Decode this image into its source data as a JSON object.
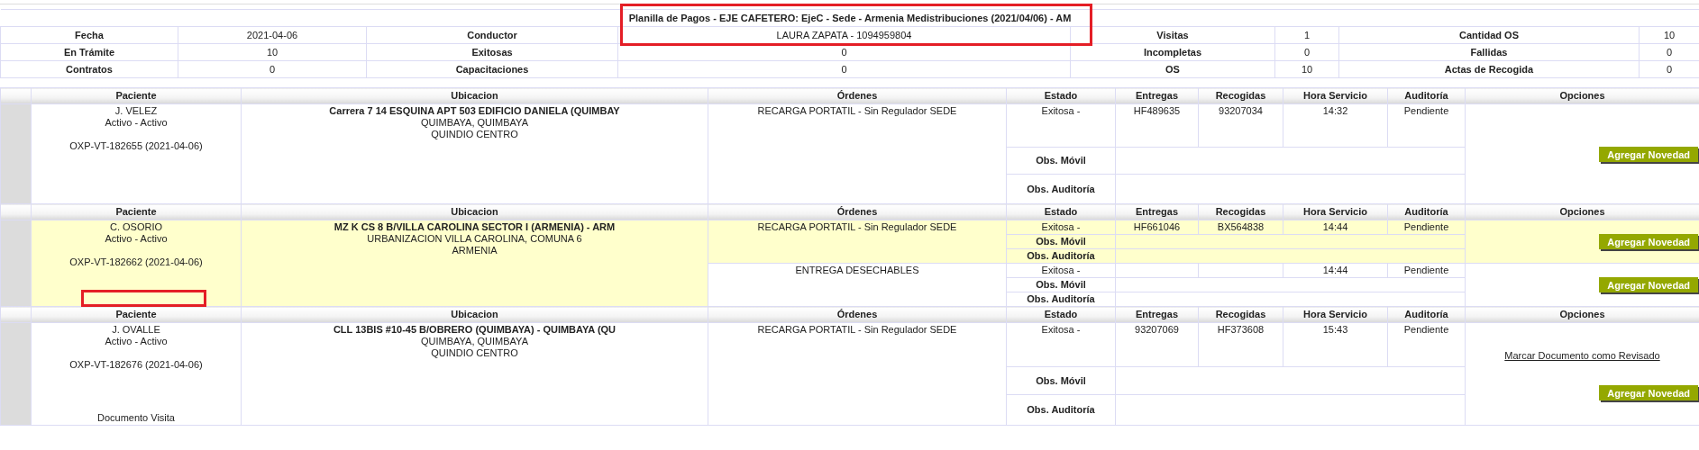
{
  "summary": {
    "title": "Planilla de Pagos - EJE CAFETERO: EjeC - Sede - Armenia Medistribuciones (2021/04/06) - AM",
    "rows": [
      [
        {
          "label": "Fecha",
          "value": "2021-04-06"
        },
        {
          "label": "Conductor",
          "value": "LAURA ZAPATA - 1094959804"
        },
        {
          "label": "Visitas",
          "value": "1"
        },
        {
          "label": "Cantidad OS",
          "value": "10"
        }
      ],
      [
        {
          "label": "En Trámite",
          "value": "10"
        },
        {
          "label": "Exitosas",
          "value": "0"
        },
        {
          "label": "Incompletas",
          "value": "0"
        },
        {
          "label": "Fallidas",
          "value": "0"
        }
      ],
      [
        {
          "label": "Contratos",
          "value": "0"
        },
        {
          "label": "Capacitaciones",
          "value": "0"
        },
        {
          "label": "OS",
          "value": "10"
        },
        {
          "label": "Actas de Recogida",
          "value": "0"
        }
      ]
    ]
  },
  "visits": [
    {
      "columns": [
        "Paciente",
        "Ubicacion",
        "Órdenes",
        "Estado",
        "Entregas",
        "Recogidas",
        "Hora Servicio",
        "Auditoría",
        "Opciones"
      ],
      "highlighted": false,
      "patient": {
        "name": "J. VELEZ",
        "status": "Activo - Activo",
        "code": "OXP-VT-182655 (2021-04-06)"
      },
      "location": [
        "Carrera 7 14 ESQUINA APT 503 EDIFICIO DANIELA (QUIMBAY",
        "QUIMBAYA, QUIMBAYA",
        "QUINDIO CENTRO"
      ],
      "orders": [
        {
          "order": "RECARGA PORTATIL - Sin Regulador SEDE",
          "status": "Exitosa -",
          "delivered": "HF489635",
          "collected": "93207034",
          "time": "14:32",
          "audit": "Pendiente",
          "obs_mobile": "Obs. Móvil",
          "obs_audit": "Obs. Auditoría",
          "button": "Agregar Novedad",
          "highlighted": false
        }
      ]
    },
    {
      "columns": [
        "Paciente",
        "Ubicacion",
        "Órdenes",
        "Estado",
        "Entregas",
        "Recogidas",
        "Hora Servicio",
        "Auditoría",
        "Opciones"
      ],
      "highlighted": true,
      "patient": {
        "name": "C. OSORIO",
        "status": "Activo - Activo",
        "code": "OXP-VT-182662 (2021-04-06)"
      },
      "location": [
        "MZ K CS 8 B/VILLA CAROLINA SECTOR I (ARMENIA) - ARM",
        "URBANIZACION VILLA CAROLINA, COMUNA 6",
        "ARMENIA"
      ],
      "orders": [
        {
          "order": "RECARGA PORTATIL - Sin Regulador SEDE",
          "status": "Exitosa -",
          "delivered": "HF661046",
          "collected": "BX564838",
          "time": "14:44",
          "audit": "Pendiente",
          "obs_mobile": "Obs. Móvil",
          "obs_audit": "Obs. Auditoría",
          "button": "Agregar Novedad",
          "highlighted": true
        },
        {
          "order": "ENTREGA DESECHABLES",
          "status": "Exitosa -",
          "time": "14:44",
          "audit": "Pendiente",
          "obs_mobile": "Obs. Móvil",
          "obs_audit": "Obs. Auditoría",
          "button": "Agregar Novedad",
          "highlighted": false
        }
      ]
    },
    {
      "columns": [
        "Paciente",
        "Ubicacion",
        "Órdenes",
        "Estado",
        "Entregas",
        "Recogidas",
        "Hora Servicio",
        "Auditoría",
        "Opciones"
      ],
      "highlighted": false,
      "patient": {
        "name": "J. OVALLE",
        "status": "Activo - Activo",
        "code": "OXP-VT-182676 (2021-04-06)",
        "document": "Documento Visita"
      },
      "location": [
        "CLL 13BIS #10-45 B/OBRERO (QUIMBAYA) - QUIMBAYA (QU",
        "QUIMBAYA, QUIMBAYA",
        "QUINDIO CENTRO"
      ],
      "orders": [
        {
          "order": "RECARGA PORTATIL - Sin Regulador SEDE",
          "status": "Exitosa -",
          "delivered": "93207069",
          "collected": "HF373608",
          "time": "15:43",
          "audit": "Pendiente",
          "obs_mobile": "Obs. Móvil",
          "obs_audit": "Obs. Auditoría",
          "link": "Marcar Documento como Revisado",
          "button": "Agregar Novedad",
          "highlighted": false
        }
      ]
    }
  ]
}
